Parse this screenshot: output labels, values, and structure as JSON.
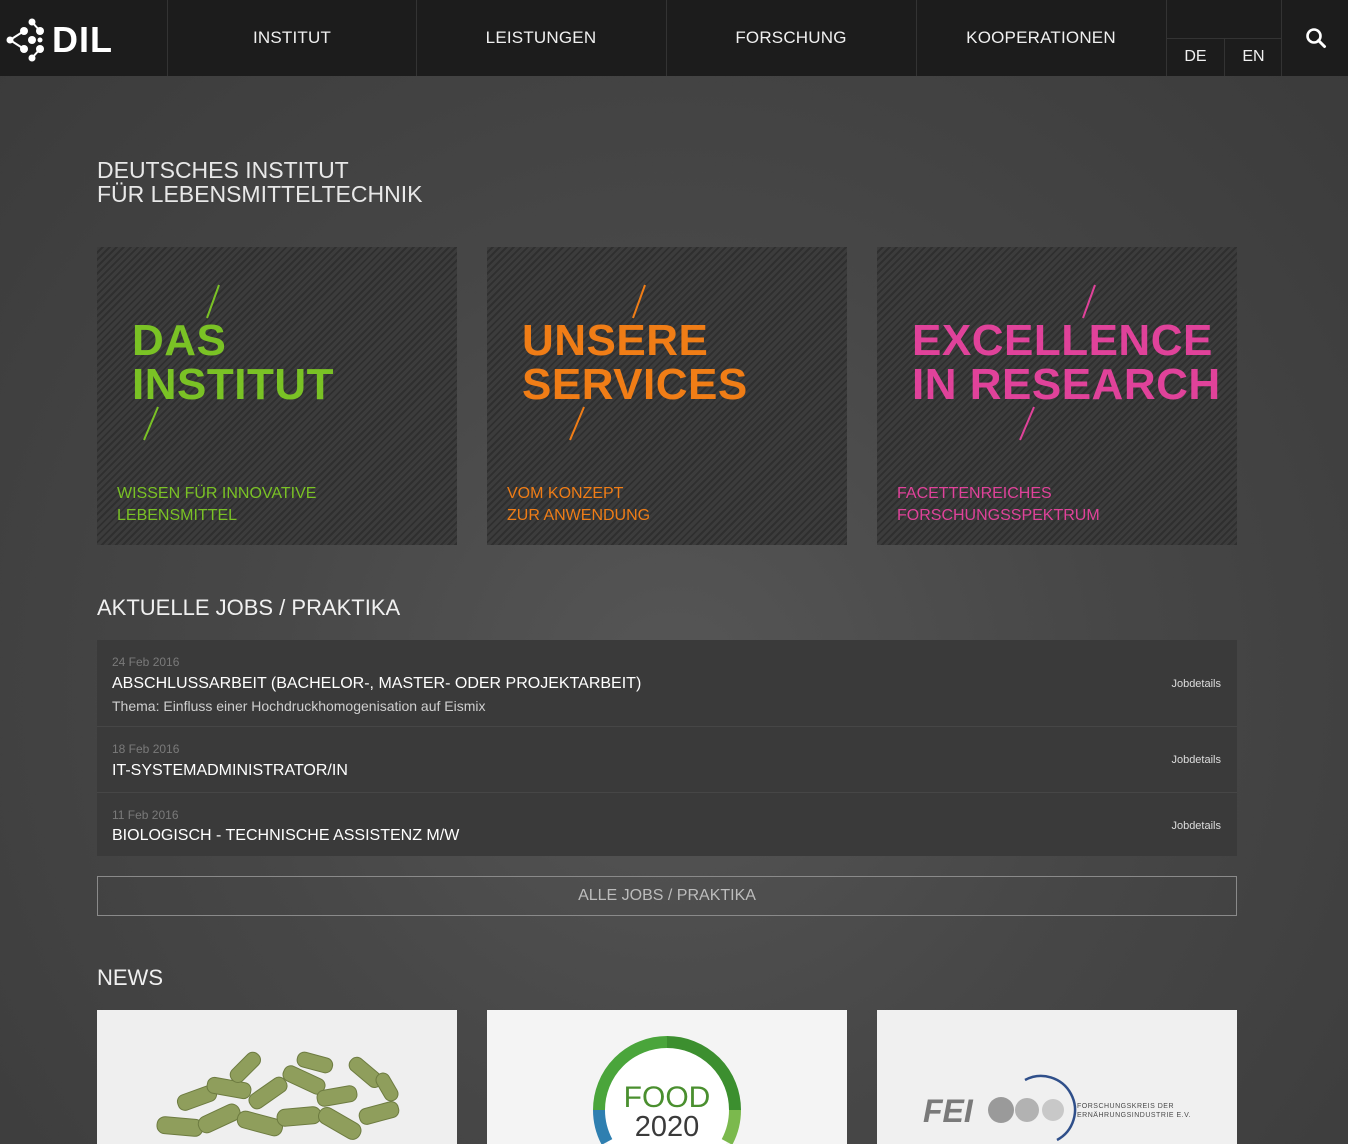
{
  "header": {
    "logo_text": "DIL",
    "nav": [
      "INSTITUT",
      "LEISTUNGEN",
      "FORSCHUNG",
      "KOOPERATIONEN"
    ],
    "languages": [
      "DE",
      "EN"
    ],
    "search_icon": "search-icon"
  },
  "intro": {
    "title_line1": "DEUTSCHES INSTITUT",
    "title_line2": "FÜR LEBENSMITTELTECHNIK"
  },
  "tiles": [
    {
      "line1": "DAS",
      "line2": "INSTITUT",
      "sub1": "WISSEN FÜR INNOVATIVE",
      "sub2": "LEBENSMITTEL",
      "color": "#7ac225"
    },
    {
      "line1": "UNSERE",
      "line2": "SERVICES",
      "sub1": "VOM KONZEPT",
      "sub2": "ZUR ANWENDUNG",
      "color": "#f07d16"
    },
    {
      "line1": "EXCELLENCE",
      "line2": "IN RESEARCH",
      "sub1": "FACETTENREICHES",
      "sub2": "FORSCHUNGSSPEKTRUM",
      "color": "#e0429a"
    }
  ],
  "jobs": {
    "heading": "AKTUELLE JOBS / PRAKTIKA",
    "items": [
      {
        "date": "24 Feb 2016",
        "title": "ABSCHLUSSARBEIT (BACHELOR-, MASTER- ODER PROJEKTARBEIT)",
        "desc": "Thema: Einfluss einer Hochdruckhomogenisation auf Eismix",
        "link": "Jobdetails"
      },
      {
        "date": "18 Feb 2016",
        "title": "IT-SYSTEMADMINISTRATOR/IN",
        "desc": "",
        "link": "Jobdetails"
      },
      {
        "date": "11 Feb 2016",
        "title": "BIOLOGISCH - TECHNISCHE ASSISTENZ M/W",
        "desc": "",
        "link": "Jobdetails"
      }
    ],
    "all_button": "ALLE JOBS / PRAKTIKA"
  },
  "news": {
    "heading": "NEWS",
    "cards": [
      {
        "image": "green-pellets-image"
      },
      {
        "image": "food-2020-logo",
        "logo_line1": "FOOD",
        "logo_line2": "2020"
      },
      {
        "image": "fei-logo",
        "logo_text": "FEI",
        "logo_sub1": "FORSCHUNGSKREIS DER",
        "logo_sub2": "ERNÄHRUNGSINDUSTRIE E.V."
      }
    ]
  }
}
